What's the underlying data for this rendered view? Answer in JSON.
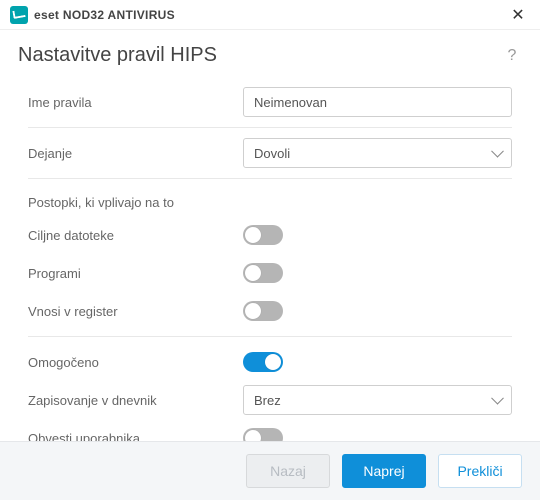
{
  "titlebar": {
    "brand_strong": "eset",
    "brand_product": "NOD32 ANTIVIRUS"
  },
  "header": {
    "title": "Nastavitve pravil HIPS"
  },
  "form": {
    "rule_name_label": "Ime pravila",
    "rule_name_value": "Neimenovan",
    "action_label": "Dejanje",
    "action_value": "Dovoli",
    "action_options": [
      "Dovoli"
    ],
    "ops_section_label": "Postopki, ki vplivajo na to",
    "target_files_label": "Ciljne datoteke",
    "target_files_on": false,
    "programs_label": "Programi",
    "programs_on": false,
    "registry_label": "Vnosi v register",
    "registry_on": false,
    "enabled_label": "Omogočeno",
    "enabled_on": true,
    "logging_label": "Zapisovanje v dnevnik",
    "logging_value": "Brez",
    "logging_options": [
      "Brez"
    ],
    "notify_label": "Obvesti uporabnika",
    "notify_on": false
  },
  "footer": {
    "back": "Nazaj",
    "next": "Naprej",
    "cancel": "Prekliči"
  },
  "icons": {
    "help": "?",
    "close": "✕"
  },
  "colors": {
    "accent": "#0f8fd9",
    "toggle_off": "#b5b5b5"
  }
}
